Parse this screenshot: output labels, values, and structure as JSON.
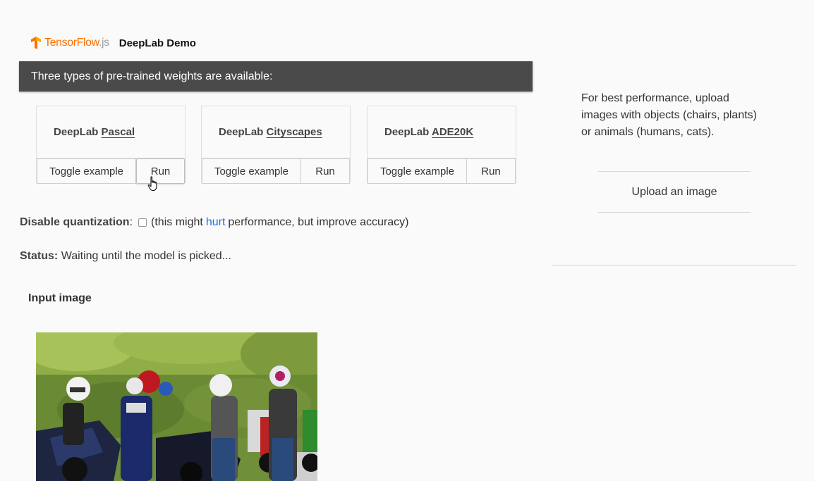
{
  "header": {
    "logo_brand": "TensorFlow",
    "logo_suffix": ".js",
    "title": "DeepLab Demo"
  },
  "banner": {
    "text": "Three types of pre-trained weights are available:"
  },
  "models": [
    {
      "prefix": "DeepLab",
      "name": "Pascal",
      "toggle_label": "Toggle example",
      "run_label": "Run"
    },
    {
      "prefix": "DeepLab",
      "name": "Cityscapes",
      "toggle_label": "Toggle example",
      "run_label": "Run"
    },
    {
      "prefix": "DeepLab",
      "name": "ADE20K",
      "toggle_label": "Toggle example",
      "run_label": "Run"
    }
  ],
  "quantization": {
    "label": "Disable quantization",
    "colon": ":",
    "checked": false,
    "note_before": "(this might",
    "note_link": "hurt",
    "note_after": "performance, but improve accuracy)"
  },
  "status": {
    "label": "Status:",
    "text": "Waiting until the model is picked..."
  },
  "input": {
    "label": "Input image"
  },
  "sidebar": {
    "hint": "For best performance, upload images with objects (chairs, plants) or animals (humans, cats).",
    "upload_label": "Upload an image"
  },
  "colors": {
    "brand_orange": "#ff6f00",
    "banner_bg": "#4a4a4a",
    "link_blue": "#1a73e8"
  },
  "icons": {
    "logo": "tensorflow-logo-icon",
    "cursor": "hand-pointer-icon"
  }
}
